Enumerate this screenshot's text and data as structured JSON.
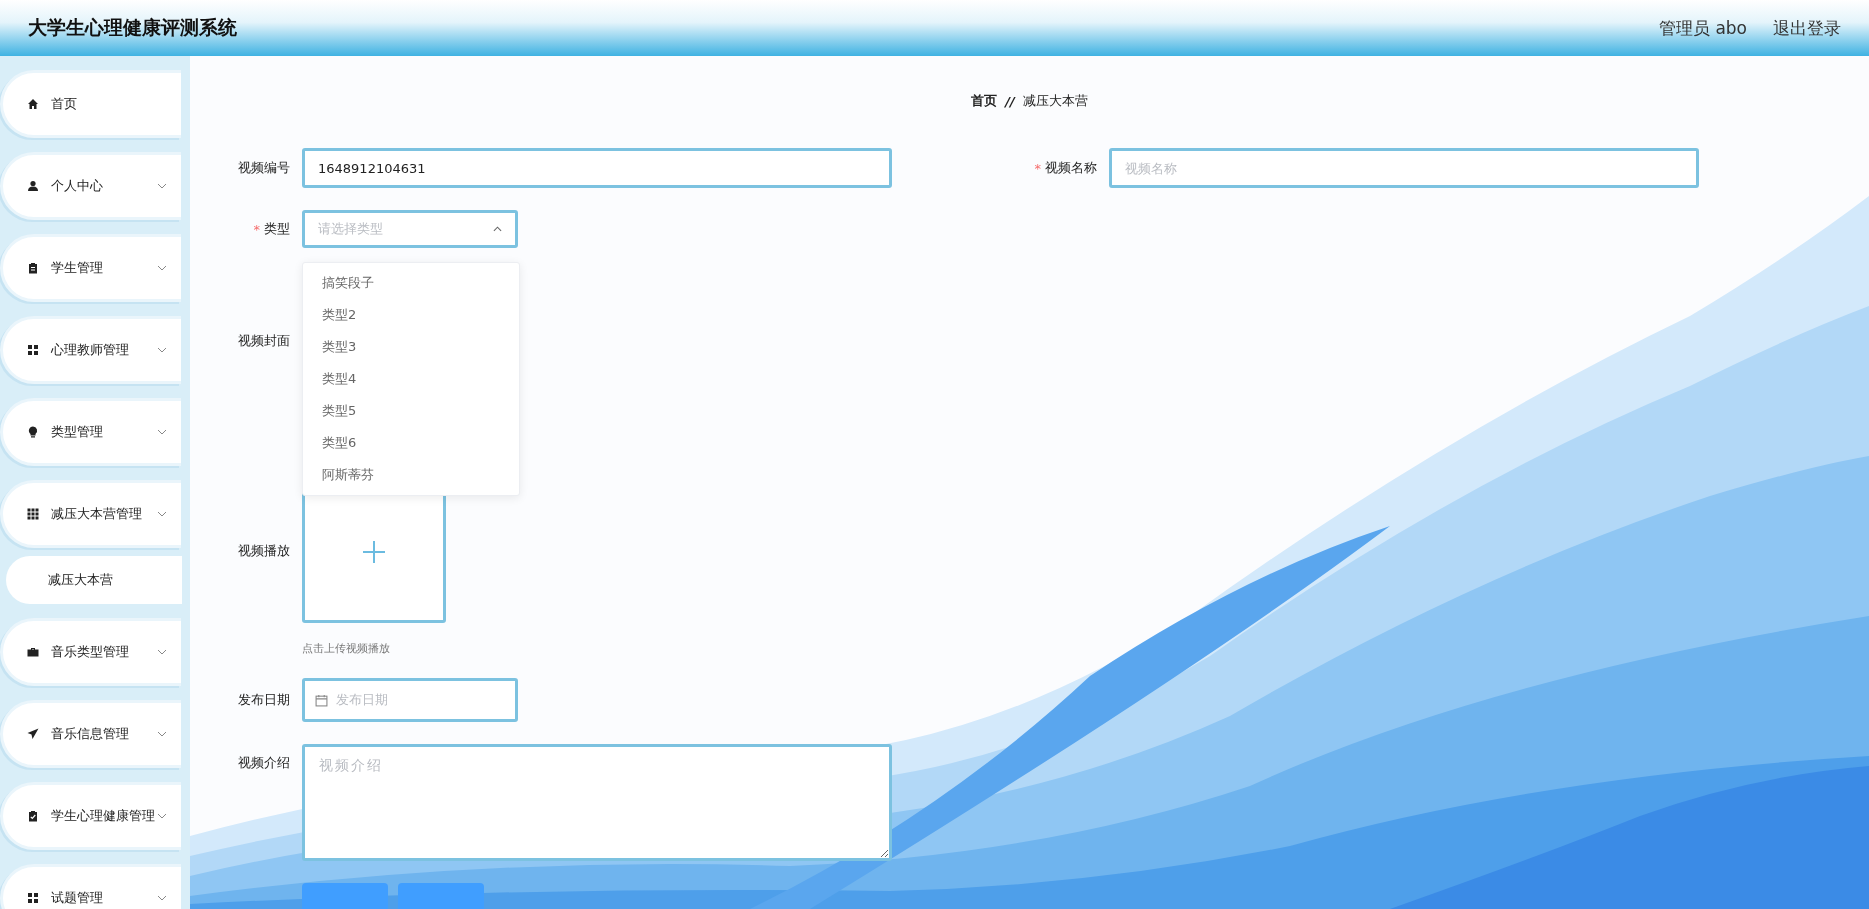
{
  "header": {
    "title": "大学生心理健康评测系统",
    "user": "管理员 abo",
    "logout": "退出登录"
  },
  "sidebar": {
    "items": [
      {
        "label": "首页",
        "kind": "link"
      },
      {
        "label": "个人中心",
        "kind": "group"
      },
      {
        "label": "学生管理",
        "kind": "group"
      },
      {
        "label": "心理教师管理",
        "kind": "group"
      },
      {
        "label": "类型管理",
        "kind": "group"
      },
      {
        "label": "减压大本营管理",
        "kind": "group",
        "children": [
          {
            "label": "减压大本营"
          }
        ]
      },
      {
        "label": "音乐类型管理",
        "kind": "group"
      },
      {
        "label": "音乐信息管理",
        "kind": "group"
      },
      {
        "label": "学生心理健康管理",
        "kind": "group"
      },
      {
        "label": "试题管理",
        "kind": "group"
      }
    ]
  },
  "breadcrumb": {
    "items": [
      "首页",
      "减压大本营"
    ],
    "separator": "//"
  },
  "form": {
    "rows": [
      [
        {
          "label": "视频编号",
          "kind": "text",
          "value": "1648912104631"
        },
        {
          "label": "视频名称",
          "kind": "text",
          "required_mark": "*",
          "placeholder": "视频名称"
        }
      ],
      [
        {
          "label": "类型",
          "kind": "select",
          "required_mark": "*",
          "placeholder": "请选择类型",
          "expanded": true
        }
      ],
      [
        {
          "label": "视频封面",
          "kind": "upload"
        }
      ],
      [
        {
          "label": "视频播放",
          "kind": "upload",
          "hint": "点击上传视频播放"
        }
      ],
      [
        {
          "label": "发布日期",
          "kind": "date",
          "placeholder": "发布日期"
        }
      ],
      [
        {
          "label": "视频介绍",
          "kind": "textarea",
          "placeholder": "视频介绍"
        }
      ]
    ],
    "dropdown": {
      "options": [
        "搞笑段子",
        "类型2",
        "类型3",
        "类型4",
        "类型5",
        "类型6",
        "阿斯蒂芬"
      ]
    }
  }
}
